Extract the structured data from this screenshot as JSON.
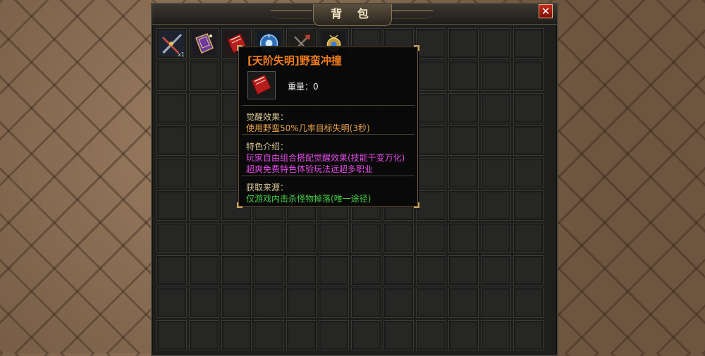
{
  "panel": {
    "title": "背 包",
    "close_label": "✕",
    "grid_columns": 12,
    "grid_rows": 10
  },
  "items": [
    {
      "icon": "twin-blades-icon",
      "qty": "x1"
    },
    {
      "icon": "purple-spellbook-icon",
      "qty": ""
    },
    {
      "icon": "red-skillbook-icon",
      "qty": ""
    },
    {
      "icon": "blue-orb-icon",
      "qty": ""
    },
    {
      "icon": "crossed-weapons-icon",
      "qty": ""
    },
    {
      "icon": "golden-amulet-icon",
      "qty": ""
    }
  ],
  "tooltip": {
    "title": "[天阶失明]野蛮冲撞",
    "weight": "重量：0",
    "sections": [
      {
        "label": "觉醒效果：",
        "lines": [
          "使用野蛮50%几率目标失明(3秒)"
        ],
        "color": "orange"
      },
      {
        "label": "特色介绍：",
        "lines": [
          "玩家自由组合搭配觉醒效果(技能千变万化)",
          "超爽免费特色体验玩法远超多职业"
        ],
        "color": "magenta"
      },
      {
        "label": "获取来源：",
        "lines": [
          "仅游戏内击杀怪物掉落(唯一途径)"
        ],
        "color": "green"
      }
    ]
  },
  "colors": {
    "title": "#f07d1c",
    "label": "#dcc99a",
    "orange": "#e8a34a",
    "magenta": "#e54ae8",
    "green": "#46d048"
  }
}
